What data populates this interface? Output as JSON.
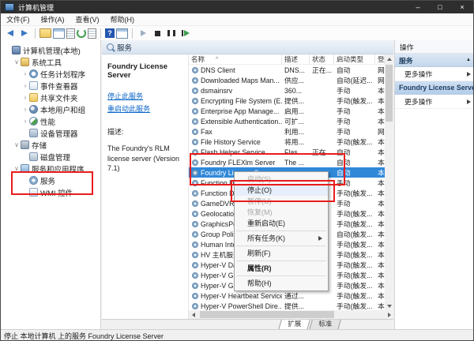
{
  "colors": {
    "selection": "#3088d8",
    "annotation": "#ea1c1c",
    "link": "#0a64c8",
    "titlebar": "#2e2e2e"
  },
  "window": {
    "title": "计算机管理",
    "controls": {
      "minimize": "–",
      "maximize": "□",
      "close": "×"
    }
  },
  "menu_bar": {
    "items": [
      {
        "label": "文件(F)"
      },
      {
        "label": "操作(A)"
      },
      {
        "label": "查看(V)"
      },
      {
        "label": "帮助(H)"
      }
    ]
  },
  "toolbar": {
    "icons": [
      {
        "icon": "back"
      },
      {
        "icon": "forward"
      },
      {
        "icon": "separator"
      },
      {
        "icon": "up-level"
      },
      {
        "icon": "show-console-tree"
      },
      {
        "icon": "properties"
      },
      {
        "icon": "refresh"
      },
      {
        "icon": "export-list"
      },
      {
        "icon": "separator"
      },
      {
        "icon": "help",
        "glyph": "?"
      },
      {
        "icon": "show-window"
      },
      {
        "icon": "separator"
      },
      {
        "icon": "start-service"
      },
      {
        "icon": "stop-service"
      },
      {
        "icon": "pause-service"
      },
      {
        "icon": "restart-service"
      }
    ]
  },
  "tree": {
    "items": [
      {
        "label": "计算机管理(本地)",
        "level": 0,
        "expander": "",
        "icon": "computer"
      },
      {
        "label": "系统工具",
        "level": 1,
        "expander": "∨",
        "icon": "system-tools"
      },
      {
        "label": "任务计划程序",
        "level": 2,
        "expander": "›",
        "icon": "task-scheduler"
      },
      {
        "label": "事件查看器",
        "level": 2,
        "expander": "›",
        "icon": "event-viewer"
      },
      {
        "label": "共享文件夹",
        "level": 2,
        "expander": "›",
        "icon": "shared-folders"
      },
      {
        "label": "本地用户和组",
        "level": 2,
        "expander": "›",
        "icon": "local-users"
      },
      {
        "label": "性能",
        "level": 2,
        "expander": "›",
        "icon": "performance"
      },
      {
        "label": "设备管理器",
        "level": 2,
        "expander": "",
        "icon": "device-manager"
      },
      {
        "label": "存储",
        "level": 1,
        "expander": "∨",
        "icon": "storage"
      },
      {
        "label": "磁盘管理",
        "level": 2,
        "expander": "",
        "icon": "disk-management"
      },
      {
        "label": "服务和应用程序",
        "level": 1,
        "expander": "∨",
        "icon": "services-apps"
      },
      {
        "label": "服务",
        "level": 2,
        "expander": "",
        "icon": "services",
        "annotated": true
      },
      {
        "label": "WMI 控件",
        "level": 2,
        "expander": "",
        "icon": "wmi"
      }
    ]
  },
  "services_pane": {
    "header": "服务",
    "info": {
      "title": "Foundry License Server",
      "stop_link": "停止此服务",
      "restart_link": "重启动此服务",
      "desc_label": "描述:",
      "desc": "The Foundry's RLM license server (Version 7.1)"
    },
    "columns": [
      {
        "label": "名称",
        "sort": "^",
        "cls": "c-name"
      },
      {
        "label": "描述",
        "cls": "c-desc"
      },
      {
        "label": "状态",
        "cls": "c-status"
      },
      {
        "label": "启动类型",
        "cls": "c-startup"
      },
      {
        "label": "登",
        "cls": "c-logon"
      }
    ],
    "rows": [
      {
        "name": "DNS Client",
        "desc": "DNS...",
        "status": "正在...",
        "startup": "自动",
        "logon": "网"
      },
      {
        "name": "Downloaded Maps Man...",
        "desc": "供应...",
        "status": "",
        "startup": "自动(延迟...",
        "logon": "网"
      },
      {
        "name": "dsmainsrv",
        "desc": "360...",
        "status": "",
        "startup": "手动",
        "logon": "本"
      },
      {
        "name": "Encrypting File System (E...",
        "desc": "提供...",
        "status": "",
        "startup": "手动(触发...",
        "logon": "本"
      },
      {
        "name": "Enterprise App Manage...",
        "desc": "启用...",
        "status": "",
        "startup": "手动",
        "logon": "本"
      },
      {
        "name": "Extensible Authentication...",
        "desc": "可扩...",
        "status": "",
        "startup": "手动",
        "logon": "本"
      },
      {
        "name": "Fax",
        "desc": "利用...",
        "status": "",
        "startup": "手动",
        "logon": "网"
      },
      {
        "name": "File History Service",
        "desc": "将用...",
        "status": "",
        "startup": "手动(触发...",
        "logon": "本"
      },
      {
        "name": "Flash Helper Service",
        "desc": "Flas...",
        "status": "正在...",
        "startup": "自动",
        "logon": "本"
      },
      {
        "name": "Foundry FLEXlm Server",
        "desc": "The ...",
        "status": "",
        "startup": "自动",
        "logon": "本"
      },
      {
        "name": "Foundry License Server",
        "desc": "",
        "status": "",
        "startup": "自动",
        "logon": "本",
        "selected": true
      },
      {
        "name": "Function Discov...",
        "desc": "",
        "status": "",
        "startup": "手动",
        "logon": "本"
      },
      {
        "name": "Function Discov...",
        "desc": "",
        "status": "",
        "startup": "手动(触发...",
        "logon": "本"
      },
      {
        "name": "GameDVR 和广...",
        "desc": "",
        "status": "",
        "startup": "手动",
        "logon": "本"
      },
      {
        "name": "Geolocation Se...",
        "desc": "",
        "status": "",
        "startup": "手动(触发...",
        "logon": "本"
      },
      {
        "name": "GraphicsPerfSv...",
        "desc": "",
        "status": "",
        "startup": "手动(触发...",
        "logon": "本"
      },
      {
        "name": "Group Policy Cl...",
        "desc": "",
        "status": "",
        "startup": "自动(触发...",
        "logon": "本"
      },
      {
        "name": "Human Interfac...",
        "desc": "",
        "status": "",
        "startup": "手动(触发...",
        "logon": "本"
      },
      {
        "name": "HV 主机服务",
        "desc": "",
        "status": "",
        "startup": "手动(触发...",
        "logon": "本"
      },
      {
        "name": "Hyper-V Data E...",
        "desc": "",
        "status": "",
        "startup": "手动(触发...",
        "logon": "本"
      },
      {
        "name": "Hyper-V Guest ...",
        "desc": "",
        "status": "",
        "startup": "手动(触发...",
        "logon": "本"
      },
      {
        "name": "Hyper-V Guest Shutdown...",
        "desc": "提供...",
        "status": "",
        "startup": "手动(触发...",
        "logon": "本"
      },
      {
        "name": "Hyper-V Heartbeat Service",
        "desc": "通过...",
        "status": "",
        "startup": "手动(触发...",
        "logon": "本"
      },
      {
        "name": "Hyper-V PowerShell Dire...",
        "desc": "提供...",
        "status": "",
        "startup": "手动(触发...",
        "logon": "本"
      }
    ],
    "tabs": [
      {
        "label": "扩展",
        "active": true
      },
      {
        "label": "标准"
      }
    ]
  },
  "context_menu": {
    "items": [
      {
        "label": "启动(S)",
        "disabled": true
      },
      {
        "label": "停止(O)",
        "highlight": true,
        "annotated": true
      },
      {
        "label": "暂停(U)",
        "disabled": true
      },
      {
        "label": "恢复(M)",
        "disabled": true
      },
      {
        "label": "重新启动(E)"
      },
      {
        "separator": true
      },
      {
        "label": "所有任务(K)",
        "submenu": true
      },
      {
        "separator": true
      },
      {
        "label": "刷新(F)"
      },
      {
        "separator": true
      },
      {
        "label": "属性(R)",
        "bold": true
      },
      {
        "separator": true
      },
      {
        "label": "帮助(H)"
      }
    ]
  },
  "actions_pane": {
    "title": "操作",
    "sections": [
      {
        "header": "服务",
        "more": "更多操作"
      },
      {
        "header": "Foundry License Server",
        "more": "更多操作",
        "alt": true
      }
    ]
  },
  "status_bar": {
    "text": "停止 本地计算机 上的服务 Foundry License Server"
  }
}
